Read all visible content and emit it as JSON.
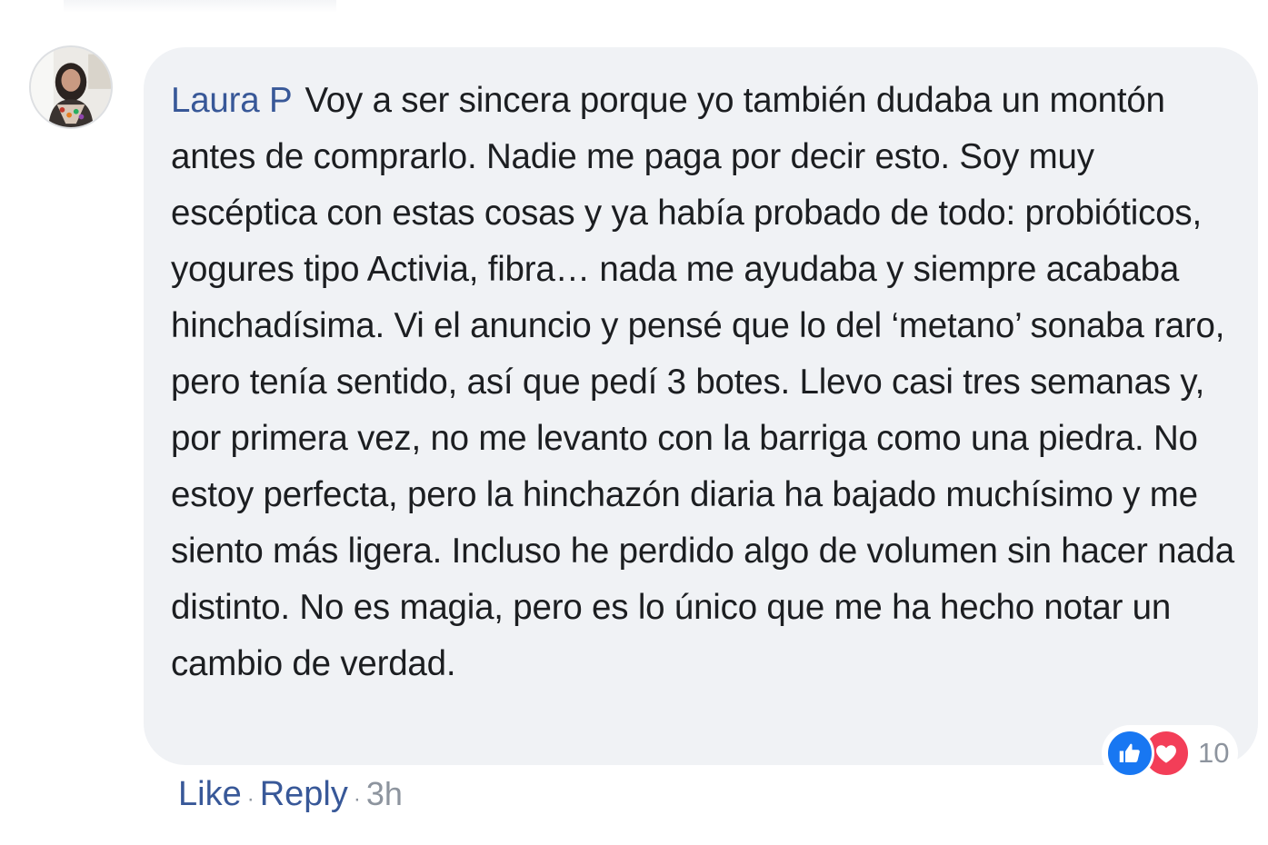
{
  "comment": {
    "author": "Laura P",
    "text": "Voy a ser sincera porque yo también dudaba un montón antes de comprarlo. Nadie me paga por decir esto. Soy muy escéptica con estas cosas y ya había probado de todo: probióticos, yogures tipo Activia, fibra… nada me ayudaba y siempre acababa hinchadísima. Vi el anuncio y pensé que lo del ‘metano’ sonaba raro, pero tenía sentido, así que pedí 3 botes. Llevo casi tres semanas y, por primera vez, no me levanto con la barriga como una piedra. No estoy perfecta, pero la hinchazón diaria ha bajado muchísimo y me siento más ligera. Incluso he perdido algo de volumen sin hacer nada distinto. No es magia, pero es lo único que me ha hecho notar un cambio de verdad."
  },
  "reactions": {
    "icons": [
      "like-icon",
      "love-icon"
    ],
    "count": "10"
  },
  "actions": {
    "like_label": "Like",
    "reply_label": "Reply",
    "separator": "·",
    "timestamp": "3h"
  },
  "colors": {
    "link": "#385898",
    "bubble": "#f0f2f5",
    "text": "#1c1e21",
    "muted": "#8d949e",
    "like": "#1877f2",
    "love": "#f33e58"
  }
}
